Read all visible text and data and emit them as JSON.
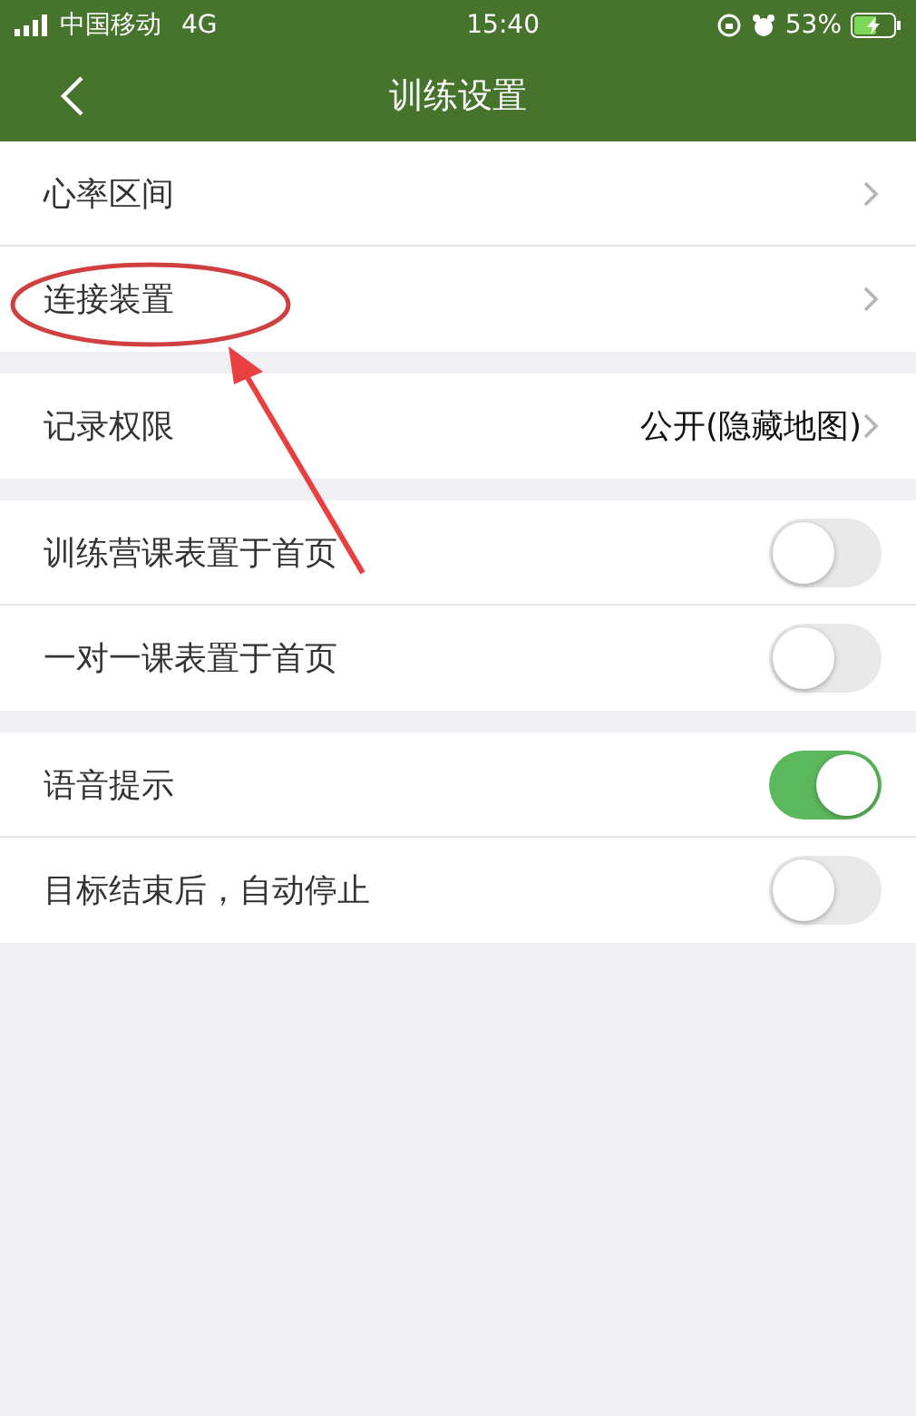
{
  "status_bar": {
    "carrier": "中国移动",
    "network": "4G",
    "time": "15:40",
    "battery": "53%"
  },
  "header": {
    "title": "训练设置"
  },
  "sections": [
    {
      "rows": [
        {
          "kind": "link",
          "label": "心率区间"
        },
        {
          "kind": "link",
          "label": "连接装置"
        }
      ]
    },
    {
      "rows": [
        {
          "kind": "link",
          "label": "记录权限",
          "value": "公开(隐藏地图)"
        }
      ]
    },
    {
      "rows": [
        {
          "kind": "toggle",
          "label": "训练营课表置于首页",
          "on": false
        },
        {
          "kind": "toggle",
          "label": "一对一课表置于首页",
          "on": false
        }
      ]
    },
    {
      "rows": [
        {
          "kind": "toggle",
          "label": "语音提示",
          "on": true
        },
        {
          "kind": "toggle",
          "label": "目标结束后，自动停止",
          "on": false
        }
      ]
    }
  ]
}
